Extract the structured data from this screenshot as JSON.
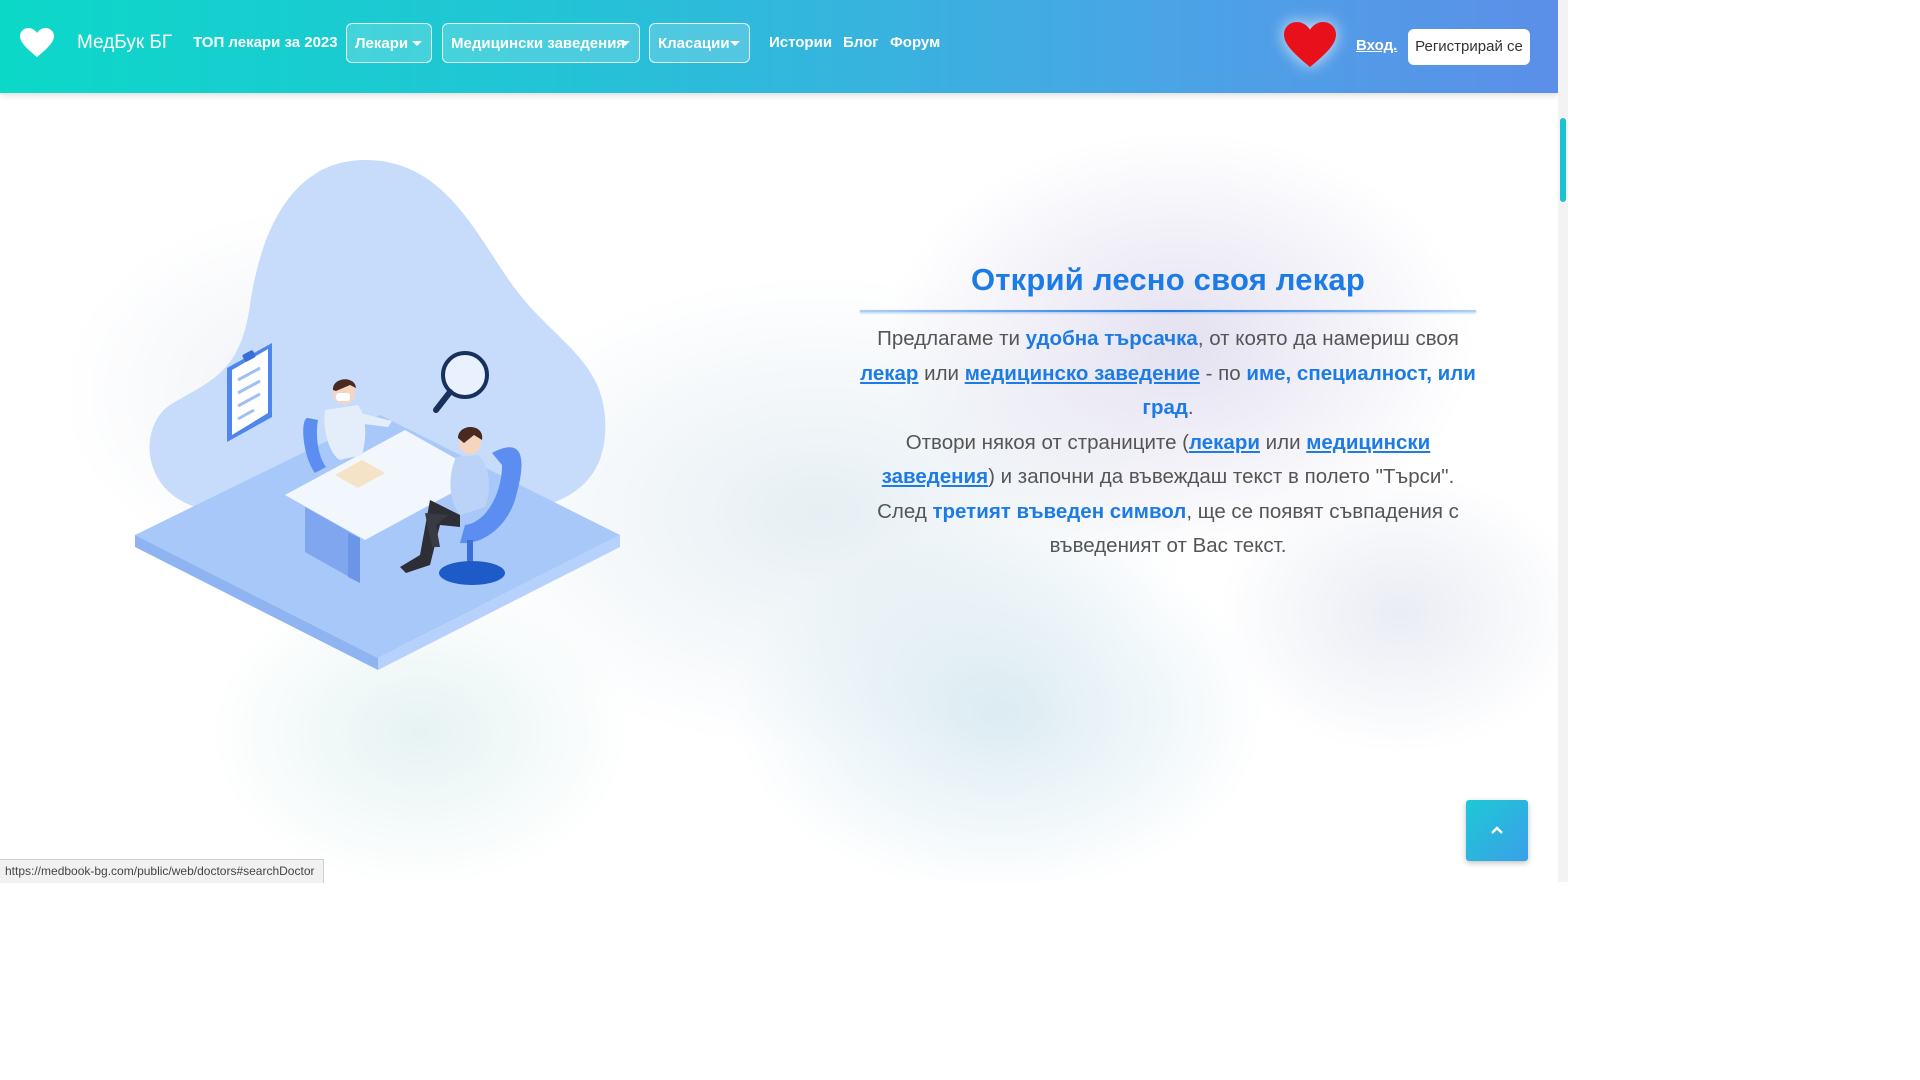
{
  "nav": {
    "brand": "МедБук БГ",
    "top_doctors": "ТОП лекари за 2023",
    "dropdowns": [
      "Лекари",
      "Медицински заведения",
      "Класации"
    ],
    "links": [
      "Истории",
      "Блог",
      "Форум"
    ],
    "login": "Вход.",
    "register": "Регистрирай се"
  },
  "hero": {
    "title": "Открий лесно своя лекар",
    "p1": {
      "t1": "Предлагаме ти ",
      "b1": "удобна търсачка",
      "t2": ", от която да намериш своя ",
      "l1": "лекар",
      "t3": " или ",
      "l2": "медицинско заведение",
      "t4": " - по ",
      "b2": "име, специалност, или град",
      "t5": "."
    },
    "p2": {
      "t1": "Отвори някоя от страниците (",
      "l1": "лекари",
      "t2": " или ",
      "l2": "медицински заведения",
      "t3": ") и започни да въвеждаш текст в полето \"Търси\". След ",
      "b1": "третият въведен символ",
      "t4": ", ще се появят съвпадения с въведеният от Вас текст."
    }
  },
  "status_bar": {
    "url": "https://medbook-bg.com/public/web/doctors#searchDoctor"
  },
  "colors": {
    "accent": "#1d7be6",
    "nav_start": "#0cd8c8",
    "nav_end": "#5c8fe8",
    "heart": "#e8111b"
  },
  "icons": {
    "logo": "heart-icon",
    "favorites": "heart-icon",
    "scroll_top": "chevron-up-icon"
  }
}
